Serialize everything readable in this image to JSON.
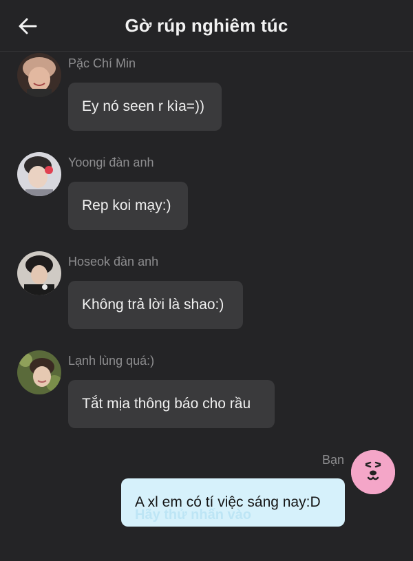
{
  "header": {
    "title": "Gờ rúp nghiêm túc",
    "back_icon": "arrow-left-icon"
  },
  "messages": [
    {
      "sender": "Pặc Chí Min",
      "text": "Ey nó seen r kìa=))",
      "avatar_color": "#8a6f5f"
    },
    {
      "sender": "Yoongi đàn anh",
      "text": "Rep koi mạy:)",
      "avatar_color": "#b9b9c2"
    },
    {
      "sender": "Hoseok đàn anh",
      "text": "Không trả lời là shao:)",
      "avatar_color": "#6f6c68"
    },
    {
      "sender": "Lạnh lùng quá:)",
      "text": "Tắt mịa thông báo cho rầu",
      "avatar_color": "#7f8a5a"
    }
  ],
  "me": {
    "label": "Bạn",
    "text": "A xl em có tí việc sáng nay:D",
    "hint": "Hãy thử nhấn vào",
    "avatar_color": "#f4a6c8"
  },
  "colors": {
    "background": "#242426",
    "bubble": "#3a3a3c",
    "my_bubble": "#d6f1fb"
  }
}
